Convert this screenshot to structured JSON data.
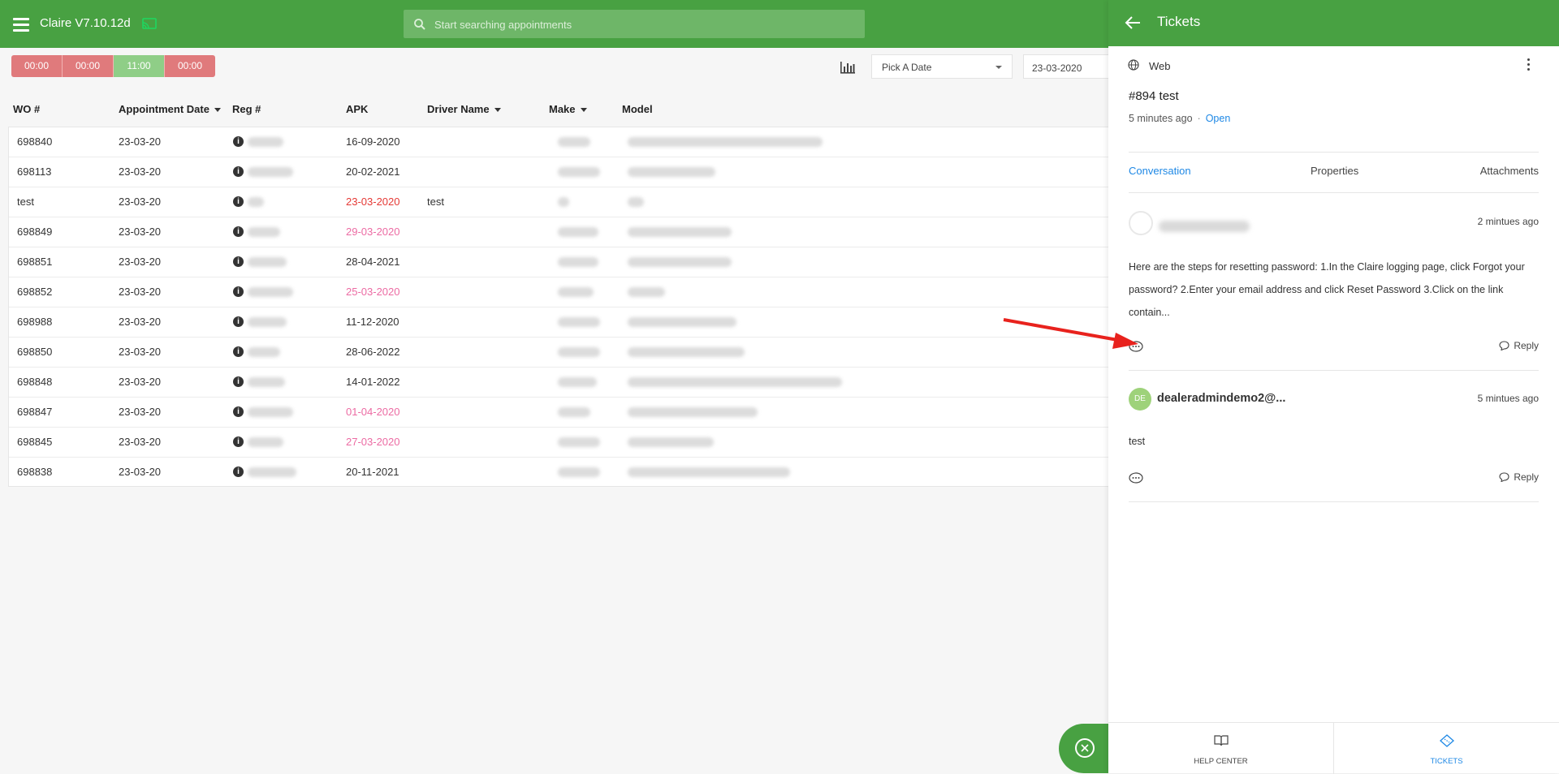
{
  "app": {
    "title": "Claire V7.10.12d"
  },
  "search": {
    "placeholder": "Start searching appointments"
  },
  "time_slots": [
    {
      "label": "00:00",
      "color": "#e07a7c"
    },
    {
      "label": "00:00",
      "color": "#e07a7c"
    },
    {
      "label": "11:00",
      "color": "#8fce87"
    },
    {
      "label": "00:00",
      "color": "#e07a7c"
    }
  ],
  "filters": {
    "pick_date_label": "Pick A Date",
    "date_value": "23-03-2020"
  },
  "table": {
    "headers": {
      "wo": "WO #",
      "appointment_date": "Appointment Date",
      "reg": "Reg #",
      "apk": "APK",
      "driver_name": "Driver Name",
      "make": "Make",
      "model": "Model"
    },
    "rows": [
      {
        "wo": "698840",
        "date": "23-03-20",
        "apk": "16-09-2020",
        "apk_status": "normal",
        "driver": ""
      },
      {
        "wo": "698113",
        "date": "23-03-20",
        "apk": "20-02-2021",
        "apk_status": "normal",
        "driver": ""
      },
      {
        "wo": "test",
        "date": "23-03-20",
        "apk": "23-03-2020",
        "apk_status": "red",
        "driver": "test"
      },
      {
        "wo": "698849",
        "date": "23-03-20",
        "apk": "29-03-2020",
        "apk_status": "pink",
        "driver": ""
      },
      {
        "wo": "698851",
        "date": "23-03-20",
        "apk": "28-04-2021",
        "apk_status": "normal",
        "driver": ""
      },
      {
        "wo": "698852",
        "date": "23-03-20",
        "apk": "25-03-2020",
        "apk_status": "pink",
        "driver": ""
      },
      {
        "wo": "698988",
        "date": "23-03-20",
        "apk": "11-12-2020",
        "apk_status": "normal",
        "driver": ""
      },
      {
        "wo": "698850",
        "date": "23-03-20",
        "apk": "28-06-2022",
        "apk_status": "normal",
        "driver": ""
      },
      {
        "wo": "698848",
        "date": "23-03-20",
        "apk": "14-01-2022",
        "apk_status": "normal",
        "driver": ""
      },
      {
        "wo": "698847",
        "date": "23-03-20",
        "apk": "01-04-2020",
        "apk_status": "pink",
        "driver": ""
      },
      {
        "wo": "698845",
        "date": "23-03-20",
        "apk": "27-03-2020",
        "apk_status": "pink",
        "driver": ""
      },
      {
        "wo": "698838",
        "date": "23-03-20",
        "apk": "20-11-2021",
        "apk_status": "normal",
        "driver": ""
      }
    ]
  },
  "panel": {
    "title": "Tickets",
    "channel": "Web",
    "ticket_title": "#894 test",
    "ticket_age": "5 minutes ago",
    "ticket_status": "Open",
    "tabs": {
      "conversation": "Conversation",
      "properties": "Properties",
      "attachments": "Attachments"
    },
    "messages": [
      {
        "time": "2 mintues ago",
        "body": "Here are the steps for resetting password: 1.In the Claire logging page, click Forgot your password? 2.Enter your email address and click Reset Password 3.Click on the link contain...",
        "reply_label": "Reply"
      },
      {
        "avatar_initials": "DE",
        "author": "dealeradmindemo2@...",
        "time": "5 mintues ago",
        "body": "test",
        "reply_label": "Reply"
      }
    ],
    "footer": {
      "help_center": "HELP CENTER",
      "tickets": "TICKETS"
    }
  },
  "colors": {
    "primary_green": "#48a142",
    "link_blue": "#1e88e5",
    "apk_red": "#e53935",
    "apk_pink": "#ec6ba3",
    "annotation_arrow": "#e8221d"
  }
}
